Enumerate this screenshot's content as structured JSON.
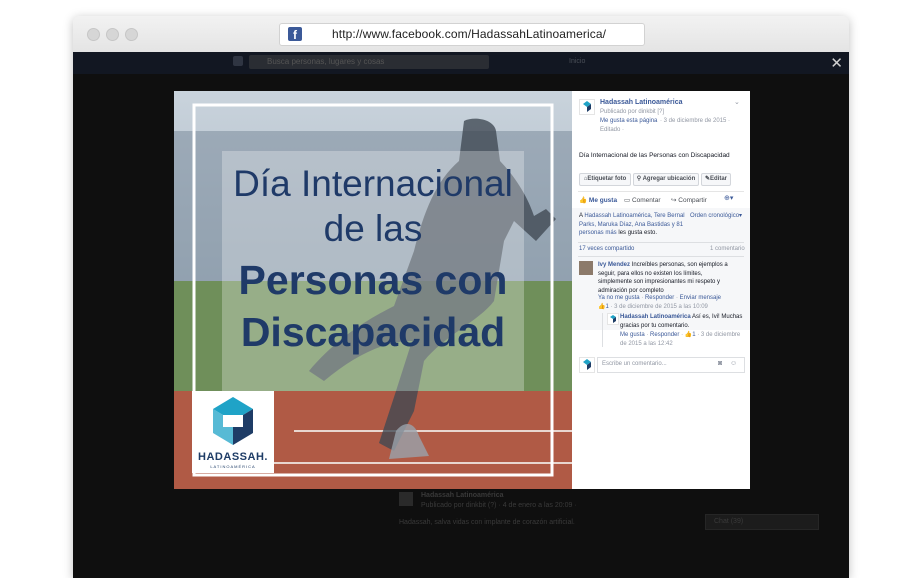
{
  "browser": {
    "url": "http://www.facebook.com/HadassahLatinoamerica/"
  },
  "fb_header": {
    "search_placeholder": "Busca personas, lugares y cosas",
    "home": "Inicio"
  },
  "background": {
    "page_name": "Hadassah Latinoamérica",
    "published": "Publicado por dinkbit (?) · 4 de enero a las 20:09 ·",
    "post_text": "Hadassah, salva vidas con implante de corazón artificial.",
    "chat_label": "Chat (39)"
  },
  "photo": {
    "line1": "Día Internacional",
    "line2": "de las",
    "line3": "Personas con",
    "line4": "Discapacidad",
    "logo_text": "HADASSAH.",
    "logo_sub": "LATINOAMÉRICA"
  },
  "post": {
    "page_name": "Hadassah Latinoamérica",
    "published_by": "Publicado por dinkbit [?]",
    "liked_page": "Me gusta esta página",
    "date": "· 3 de diciembre de 2015 ·",
    "edited": "Editado ·",
    "text": "Día Internacional de las Personas con Discapacidad",
    "tag_photo": "Etiquetar foto",
    "add_location": "Agregar ubicación",
    "edit": "Editar",
    "like": "Me gusta",
    "comment": "Comentar",
    "share": "Compartir",
    "likers_prefix": "A",
    "likers_names": "Hadassah Latinoamérica, Tere Bernal Parks, Maruka Díaz, Ana Bastidas y 81 personas más",
    "likers_suffix": "les gusta esto.",
    "order": "Orden cronológico",
    "shares": "17 veces compartido",
    "comments_count": "1 comentario",
    "comment_author": "Ivy Mendez",
    "comment_text": "Increíbles personas, son ejemplos a seguir, para ellos no existen los límites, simplemente son impresionantes mi respeto y admiración por completo",
    "comment_unlike": "Ya no me gusta",
    "comment_reply": "Responder",
    "comment_message": "Enviar mensaje",
    "comment_likes": "1",
    "comment_date": "· 3 de diciembre de 2015 a las 10:09",
    "reply_author": "Hadassah Latinoamérica",
    "reply_text": "Así es, Ivi! Muchas gracias por tu comentario.",
    "reply_like": "Me gusta",
    "reply_reply": "Responder",
    "reply_likes": "1",
    "reply_date": "· 3 de diciembre de 2015 a las 12:42",
    "write_placeholder": "Escribe un comentario..."
  },
  "colors": {
    "brand_blue": "#3b5998",
    "title_navy": "#1f3a68",
    "logo_teal": "#1fa3c7",
    "logo_navy": "#1e3c66"
  }
}
